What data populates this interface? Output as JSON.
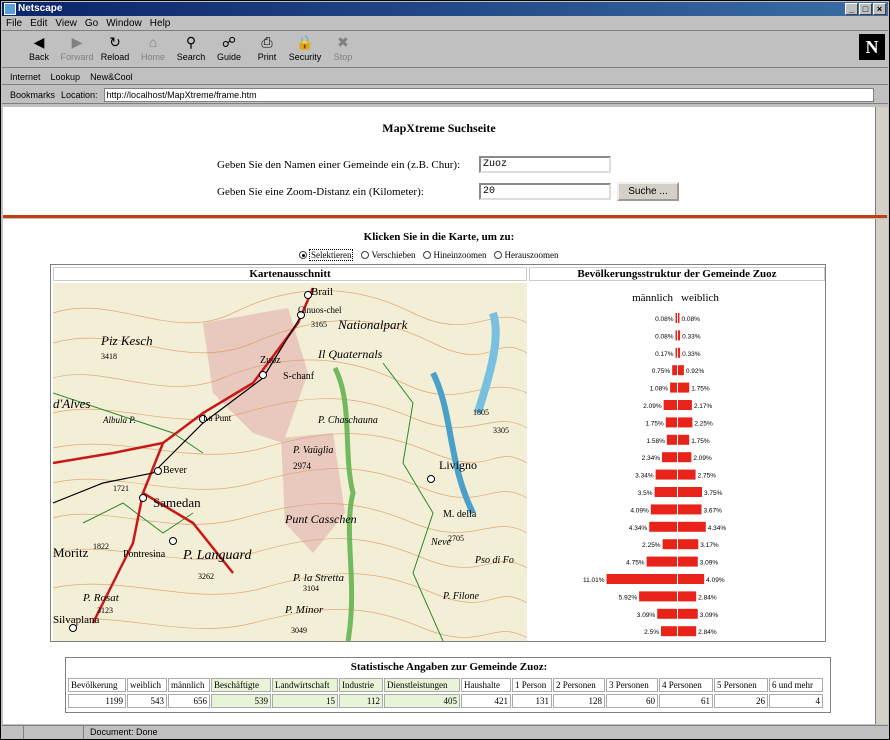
{
  "window": {
    "title": "Netscape",
    "controls": [
      "_",
      "□",
      "×"
    ]
  },
  "menu": [
    "File",
    "Edit",
    "View",
    "Go",
    "Window",
    "Help"
  ],
  "toolbar": [
    {
      "label": "Back",
      "icon": "back-arrow-icon",
      "glyph": "◀",
      "enabled": true
    },
    {
      "label": "Forward",
      "icon": "forward-arrow-icon",
      "glyph": "▶",
      "enabled": false
    },
    {
      "label": "Reload",
      "icon": "reload-icon",
      "glyph": "↻",
      "enabled": true
    },
    {
      "label": "Home",
      "icon": "home-icon",
      "glyph": "⌂",
      "enabled": false
    },
    {
      "label": "Search",
      "icon": "search-icon",
      "glyph": "⚲",
      "enabled": true
    },
    {
      "label": "Guide",
      "icon": "guide-icon",
      "glyph": "☍",
      "enabled": true
    },
    {
      "label": "Print",
      "icon": "print-icon",
      "glyph": "⎙",
      "enabled": true
    },
    {
      "label": "Security",
      "icon": "security-icon",
      "glyph": "🔒",
      "enabled": true
    },
    {
      "label": "Stop",
      "icon": "stop-icon",
      "glyph": "✖",
      "enabled": false
    }
  ],
  "logo": "N",
  "personal": [
    "Internet",
    "Lookup",
    "New&Cool"
  ],
  "location": {
    "bookmarks": "Bookmarks",
    "label": "Location:",
    "url": "http://localhost/MapXtreme/frame.htm"
  },
  "search": {
    "title": "MapXtreme Suchseite",
    "label_name": "Geben Sie den Namen einer Gemeinde ein (z.B. Chur):",
    "value_name": "Zuoz",
    "label_zoom": "Geben Sie eine Zoom-Distanz ein (Kilometer):",
    "value_zoom": "20",
    "button": "Suche ..."
  },
  "map": {
    "instruction": "Klicken Sie in die Karte, um zu:",
    "modes": [
      {
        "label": "Selektieren",
        "selected": true
      },
      {
        "label": "Verschieben",
        "selected": false
      },
      {
        "label": "Hineinzoomen",
        "selected": false
      },
      {
        "label": "Herauszoomen",
        "selected": false
      }
    ],
    "map_title": "Kartenausschnitt",
    "labels": [
      "Brail",
      "Cinuos-chel",
      "Nationalpark",
      "Piz Kesch",
      "3418",
      "3165",
      "Il Quaternals",
      "Zuoz",
      "S-chanf",
      "d'Alves",
      "Albula P.",
      "La Punt",
      "P. Chaschauna",
      "Bever",
      "2974",
      "P. Vaüglia",
      "Livigno",
      "Samedan",
      "M. della",
      "Moritz",
      "Pontresina",
      "P. Languard",
      "Punt Casschen",
      "Neve",
      "3262",
      "P. la Stretta",
      "Pso di Fo",
      "P. Filone",
      "Silvaplana",
      "P. Minor",
      "3049",
      "2705",
      "1805",
      "3305",
      "3104",
      "P. Rosat",
      "3123",
      "1721",
      "1822"
    ],
    "pyramid_title": "Bevölkerungsstruktur der Gemeinde Zuoz",
    "male_label": "männlich",
    "female_label": "weiblich"
  },
  "chart_data": {
    "type": "bar",
    "title": "Bevölkerungsstruktur der Gemeinde Zuoz",
    "series": [
      {
        "name": "männlich",
        "values": [
          0.08,
          0.08,
          0.17,
          0.75,
          1.08,
          2.09,
          1.75,
          1.58,
          2.34,
          3.34,
          3.5,
          4.09,
          4.34,
          2.25,
          4.75,
          11.01,
          5.92,
          3.09,
          2.5
        ],
        "labels": [
          "0.08%",
          "0.08%",
          "0.17%",
          "0.75%",
          "1.08%",
          "2.09%",
          "1.75%",
          "1.58%",
          "2.34%",
          "3.34%",
          "3.5%",
          "4.09%",
          "4.34%",
          "2.25%",
          "4.75%",
          "11.01%",
          "5.92%",
          "3.09%",
          "2.5%"
        ]
      },
      {
        "name": "weiblich",
        "values": [
          0.08,
          0.33,
          0.33,
          0.92,
          1.75,
          2.17,
          2.25,
          1.75,
          2.09,
          2.75,
          3.75,
          3.67,
          4.34,
          3.17,
          3.09,
          4.09,
          2.84,
          3.09,
          2.84
        ],
        "labels": [
          "0.08%",
          "0.33%",
          "0.33%",
          "0.92%",
          "1.75%",
          "2.17%",
          "2.25%",
          "1.75%",
          "2.09%",
          "2.75%",
          "3.75%",
          "3.67%",
          "4.34%",
          "3.17%",
          "3.09%",
          "4.09%",
          "2.84%",
          "3.09%",
          "2.84%"
        ]
      }
    ],
    "bar_color": "#e8241a"
  },
  "stats": {
    "title": "Statistische Angaben zur Gemeinde Zuoz:",
    "headers": [
      "Bevölkerung",
      "weiblich",
      "männlich",
      "Beschäftigte",
      "Landwirtschaft",
      "Industrie",
      "Dienstleistungen",
      "Haushalte",
      "1 Person",
      "2 Personen",
      "3 Personen",
      "4 Personen",
      "5 Personen",
      "6 und mehr"
    ],
    "values": [
      "1199",
      "543",
      "656",
      "539",
      "15",
      "112",
      "405",
      "421",
      "131",
      "128",
      "60",
      "61",
      "26",
      "4"
    ]
  },
  "status": {
    "text": "Document: Done"
  }
}
